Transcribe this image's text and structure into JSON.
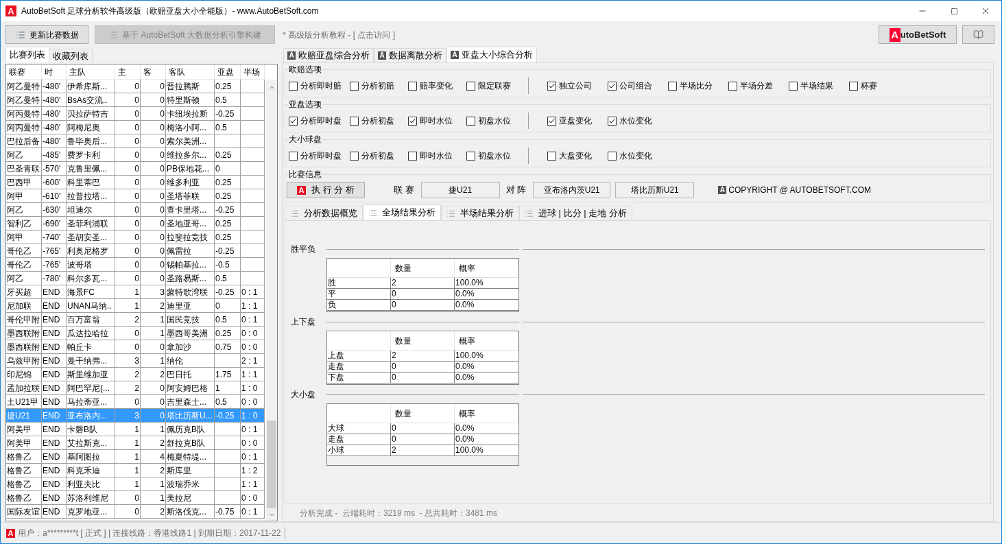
{
  "window": {
    "mark": "A",
    "title": "AutoBetSoft 足球分析软件高级版（欧赔亚盘大小全能版）-  www.AutoBetSoft.com"
  },
  "toolbar": {
    "buttons": [
      {
        "label": "更新比赛数据",
        "disabled": false
      },
      {
        "label": "基于 AutoBetSoft 大数据分析引擎构建",
        "disabled": true
      }
    ],
    "tutorial_link": "* 高级版分析教程 - [ 点击访问 ]",
    "brand_button": {
      "mark": "A",
      "label": "utoBetSoft"
    }
  },
  "left_tabs": [
    {
      "label": "比赛列表",
      "selected": true
    },
    {
      "label": "收藏列表",
      "selected": false
    }
  ],
  "match_table": {
    "columns": [
      "联赛",
      "时",
      "主队",
      "主",
      "客",
      "客队",
      "亚盘",
      "半场"
    ],
    "rows": [
      {
        "league": "阿乙曼特",
        "time": "-480'",
        "home": "伊希库斯...",
        "home_goals": "0",
        "away_goals": "0",
        "away": "晋拉腾斯",
        "handicap": "0.25",
        "selected": false
      },
      {
        "league": "阿乙曼特",
        "time": "-480'",
        "home": "BsAs交流..",
        "home_goals": "0",
        "away_goals": "0",
        "away": "特里斯顿",
        "handicap": "0.5",
        "selected": false
      },
      {
        "league": "阿丙曼特",
        "time": "-480'",
        "home": "贝拉萨特吉",
        "home_goals": "0",
        "away_goals": "0",
        "away": "卡纽埃拉斯",
        "handicap": "-0.25",
        "selected": false
      },
      {
        "league": "阿丙曼特",
        "time": "-480'",
        "home": "阿梅尼奥",
        "home_goals": "0",
        "away_goals": "0",
        "away": "梅洛小阿...",
        "handicap": "0.5",
        "selected": false
      },
      {
        "league": "巴拉后备",
        "time": "-480'",
        "home": "鲁毕奥后...",
        "home_goals": "0",
        "away_goals": "0",
        "away": "索尔美洲...",
        "selected": false
      },
      {
        "league": "阿乙",
        "time": "-485'",
        "home": "费罗卡利",
        "home_goals": "0",
        "away_goals": "0",
        "away": "维拉多尔...",
        "handicap": "0.25",
        "selected": false
      },
      {
        "league": "巴圣青联",
        "time": "-570'",
        "home": "克鲁里佩...",
        "home_goals": "0",
        "away_goals": "0",
        "away": "PB保地花...",
        "handicap": "0",
        "selected": false
      },
      {
        "league": "巴西甲",
        "time": "-600'",
        "home": "科里蒂巴",
        "home_goals": "0",
        "away_goals": "0",
        "away": "维多利亚",
        "handicap": "0.25",
        "selected": false
      },
      {
        "league": "阿甲",
        "time": "-610'",
        "home": "拉普拉塔...",
        "home_goals": "0",
        "away_goals": "0",
        "away": "圣塔菲联",
        "handicap": "0.25",
        "selected": false
      },
      {
        "league": "阿乙",
        "time": "-630'",
        "home": "坦迪尔",
        "home_goals": "0",
        "away_goals": "0",
        "away": "查卡里塔...",
        "handicap": "-0.25",
        "selected": false
      },
      {
        "league": "智利乙",
        "time": "-690'",
        "home": "圣菲利浦联",
        "home_goals": "0",
        "away_goals": "0",
        "away": "圣地亚哥...",
        "handicap": "0.25",
        "selected": false
      },
      {
        "league": "阿甲",
        "time": "-740'",
        "home": "圣胡安圣...",
        "home_goals": "0",
        "away_goals": "0",
        "away": "拉斐拉竞技",
        "handicap": "0.25",
        "selected": false
      },
      {
        "league": "哥伦乙",
        "time": "-765'",
        "home": "利奥尼格罗",
        "home_goals": "0",
        "away_goals": "0",
        "away": "佩雷拉",
        "handicap": "-0.25",
        "selected": false
      },
      {
        "league": "哥伦乙",
        "time": "-765'",
        "home": "波哥塔",
        "home_goals": "0",
        "away_goals": "0",
        "away": "锡帕基拉...",
        "handicap": "-0.5",
        "selected": false
      },
      {
        "league": "阿乙",
        "time": "-780'",
        "home": "科尔多瓦...",
        "home_goals": "0",
        "away_goals": "0",
        "away": "圣路易斯...",
        "handicap": "0.5",
        "selected": false
      },
      {
        "league": "牙买超",
        "time": "END",
        "home": "海景FC",
        "home_goals": "1",
        "away_goals": "3",
        "away": "蒙特歌湾联",
        "handicap": "-0.25",
        "half": "0 : 1",
        "selected": false
      },
      {
        "league": "尼加联",
        "time": "END",
        "home": "UNAN马纳..",
        "home_goals": "1",
        "away_goals": "2",
        "away": "迪里亚",
        "handicap": "0",
        "half": "1 : 1",
        "selected": false
      },
      {
        "league": "哥伦甲附",
        "time": "END",
        "home": "百万富翁",
        "home_goals": "2",
        "away_goals": "1",
        "away": "国民竞技",
        "handicap": "0.5",
        "half": "0 : 1",
        "selected": false
      },
      {
        "league": "墨西联附",
        "time": "END",
        "home": "瓜达拉哈拉",
        "home_goals": "0",
        "away_goals": "1",
        "away": "墨西哥美洲",
        "handicap": "0.25",
        "half": "0 : 0",
        "selected": false
      },
      {
        "league": "墨西联附",
        "time": "END",
        "home": "帕丘卡",
        "home_goals": "0",
        "away_goals": "0",
        "away": "拿加沙",
        "handicap": "0.75",
        "half": "0 : 0",
        "selected": false
      },
      {
        "league": "乌兹甲附",
        "time": "END",
        "home": "曼干纳弗...",
        "home_goals": "3",
        "away_goals": "1",
        "away": "纳伦",
        "half": "2 : 1",
        "selected": false
      },
      {
        "league": "印尼锦",
        "time": "END",
        "home": "斯里维加亚",
        "home_goals": "2",
        "away_goals": "2",
        "away": "巴日托",
        "handicap": "1.75",
        "half": "1 : 1",
        "selected": false
      },
      {
        "league": "孟加拉联",
        "time": "END",
        "home": "阿巴罕尼(...",
        "home_goals": "2",
        "away_goals": "0",
        "away": "阿安姆巴格",
        "handicap": "1",
        "half": "1 : 0",
        "selected": false
      },
      {
        "league": "土U21甲",
        "time": "END",
        "home": "马拉蒂亚...",
        "home_goals": "0",
        "away_goals": "0",
        "away": "吉里森士...",
        "handicap": "0.5",
        "half": "0 : 0",
        "selected": false
      },
      {
        "league": "捷U21",
        "time": "END",
        "home": "亚布洛内...",
        "home_goals": "3",
        "away_goals": "0",
        "away": "塔比历斯U...",
        "handicap": "-0.25",
        "half": "1 : 0",
        "selected": true
      },
      {
        "league": "阿美甲",
        "time": "END",
        "home": "卡磐B队",
        "home_goals": "1",
        "away_goals": "1",
        "away": "佩历克B队",
        "half": "0 : 1",
        "selected": false
      },
      {
        "league": "阿美甲",
        "time": "END",
        "home": "艾拉斯克...",
        "home_goals": "1",
        "away_goals": "2",
        "away": "舒拉克B队",
        "half": "0 : 0",
        "selected": false
      },
      {
        "league": "格鲁乙",
        "time": "END",
        "home": "基阿图拉",
        "home_goals": "1",
        "away_goals": "4",
        "away": "梅夏特堤...",
        "half": "0 : 1",
        "selected": false
      },
      {
        "league": "格鲁乙",
        "time": "END",
        "home": "科克禾迪",
        "home_goals": "1",
        "away_goals": "2",
        "away": "斯库里",
        "half": "1 : 2",
        "selected": false
      },
      {
        "league": "格鲁乙",
        "time": "END",
        "home": "利亚夫比",
        "home_goals": "1",
        "away_goals": "1",
        "away": "波瑞乔米",
        "half": "1 : 1",
        "selected": false
      },
      {
        "league": "格鲁乙",
        "time": "END",
        "home": "苏洛利维尼",
        "home_goals": "0",
        "away_goals": "1",
        "away": "美拉尼",
        "half": "0 : 0",
        "selected": false
      },
      {
        "league": "国际友谊",
        "time": "END",
        "home": "克罗地亚...",
        "home_goals": "0",
        "away_goals": "2",
        "away": "斯洛伐克...",
        "handicap": "-0.75",
        "half": "0 : 1",
        "selected": false
      }
    ]
  },
  "right_tabs": [
    {
      "mark": "A",
      "label": "欧赔亚盘综合分析",
      "selected": false
    },
    {
      "mark": "A",
      "label": "数据离散分析",
      "selected": false
    },
    {
      "mark": "A",
      "label": "亚盘大小综合分析",
      "selected": true
    }
  ],
  "option_groups": [
    {
      "title": "欧赔选项",
      "primary": [
        {
          "label": "分析即时赔",
          "checked": false
        },
        {
          "label": "分析初赔",
          "checked": false
        },
        {
          "label": "赔率变化",
          "checked": false
        },
        {
          "label": "限定联赛",
          "checked": false
        }
      ],
      "secondary": [
        {
          "label": "独立公司",
          "checked": true
        },
        {
          "label": "公司组合",
          "checked": true
        },
        {
          "label": "半场比分",
          "checked": false
        },
        {
          "label": "半场分差",
          "checked": false
        },
        {
          "label": "半场结果",
          "checked": false
        },
        {
          "label": "杯赛",
          "checked": false
        }
      ]
    },
    {
      "title": "亚盘选项",
      "primary": [
        {
          "label": "分析即时盘",
          "checked": true
        },
        {
          "label": "分析初盘",
          "checked": false
        },
        {
          "label": "即时水位",
          "checked": true
        },
        {
          "label": "初盘水位",
          "checked": false
        }
      ],
      "secondary": [
        {
          "label": "亚盘变化",
          "checked": true
        },
        {
          "label": "水位变化",
          "checked": true
        }
      ]
    },
    {
      "title": "大小球盘",
      "primary": [
        {
          "label": "分析即时盘",
          "checked": false
        },
        {
          "label": "分析初盘",
          "checked": false
        },
        {
          "label": "即时水位",
          "checked": false
        },
        {
          "label": "初盘水位",
          "checked": false
        }
      ],
      "secondary": [
        {
          "label": "大盘变化",
          "checked": false
        },
        {
          "label": "水位变化",
          "checked": false
        }
      ]
    }
  ],
  "match_info": {
    "title": "比赛信息",
    "run_button": {
      "mark": "A",
      "label": "执 行 分 析"
    },
    "league_label": "联 赛",
    "league": "捷U21",
    "versus_label": "对 阵",
    "home": "亚布洛内茨U21",
    "away": "塔比历斯U21",
    "copyright": {
      "mark": "A",
      "text": "COPYRIGHT @ AUTOBETSOFT.COM"
    }
  },
  "result_tabs": [
    {
      "label": "分析数据概览",
      "selected": false
    },
    {
      "label": "全场结果分析",
      "selected": true
    },
    {
      "label": "半场结果分析",
      "selected": false
    },
    {
      "label": "进球 | 比分 | 走地 分析",
      "selected": false
    }
  ],
  "result_sections": [
    {
      "title": "胜平负",
      "columns": [
        "数量",
        "概率"
      ],
      "rows": [
        {
          "label": "胜",
          "count": "2",
          "rate": "100.0%"
        },
        {
          "label": "平",
          "count": "0",
          "rate": "0.0%"
        },
        {
          "label": "负",
          "count": "0",
          "rate": "0.0%"
        }
      ]
    },
    {
      "title": "上下盘",
      "columns": [
        "数量",
        "概率"
      ],
      "rows": [
        {
          "label": "上盘",
          "count": "2",
          "rate": "100.0%"
        },
        {
          "label": "走盘",
          "count": "0",
          "rate": "0.0%"
        },
        {
          "label": "下盘",
          "count": "0",
          "rate": "0.0%"
        }
      ]
    },
    {
      "title": "大小盘",
      "columns": [
        "数量",
        "概率"
      ],
      "rows": [
        {
          "label": "大球",
          "count": "0",
          "rate": "0.0%"
        },
        {
          "label": "走盘",
          "count": "0",
          "rate": "0.0%"
        },
        {
          "label": "小球",
          "count": "2",
          "rate": "100.0%"
        }
      ]
    }
  ],
  "analysis_status": "分析完成 -  云端耗时：3219 ms  - 总共耗时：3481 ms",
  "status_bar": {
    "mark": "A",
    "text": "用户：a*********t [ 正式 ] | 连接线路：香港线路1 | 到期日期：2017-11-22"
  }
}
